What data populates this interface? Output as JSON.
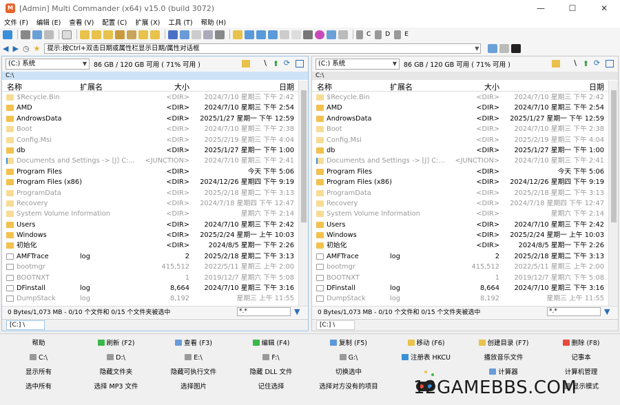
{
  "window": {
    "title": "[Admin] Multi Commander (x64)  v15.0 (build 3072)",
    "minimize": "—",
    "maximize": "☐",
    "close": "✕"
  },
  "menu": [
    "文件 (F)",
    "编辑 (E)",
    "查看 (V)",
    "配置 (C)",
    "扩展 (X)",
    "工具 (T)",
    "帮助 (H)"
  ],
  "drives": [
    "C",
    "D",
    "E"
  ],
  "cmdline": {
    "placeholder": "提示:按Ctrl+双击日期或属性栏显示日期/属性对话框"
  },
  "left": {
    "drive": "(C:) 系统",
    "free": "86 GB / 120 GB 可用 ( 71% 可用 )",
    "path": "C:\\",
    "headers": {
      "name": "名称",
      "ext": "扩展名",
      "size": "大小",
      "date": "日期"
    },
    "status": "0 Bytes/1,073 MB - 0/10 个文件和 0/15 个文件夹被选中",
    "filter": "*.*",
    "tab": "[C:] \\"
  },
  "right": {
    "drive": "(C:) 系统",
    "free": "86 GB / 120 GB 可用 ( 71% 可用 )",
    "path": "C:\\",
    "headers": {
      "name": "名称",
      "ext": "扩展名",
      "size": "大小",
      "date": "日期"
    },
    "status": "0 Bytes/1,073 MB - 0/10 个文件和 0/15 个文件夹被选中",
    "filter": "*.*",
    "tab": "[C:] \\"
  },
  "files": [
    {
      "name": "$Recycle.Bin",
      "ext": "",
      "size": "<DIR>",
      "date": "2024/7/10 星期三 下午 2:42",
      "hidden": true,
      "type": "folder"
    },
    {
      "name": "AMD",
      "ext": "",
      "size": "<DIR>",
      "date": "2024/7/10 星期三 下午 2:54",
      "hidden": false,
      "type": "folder"
    },
    {
      "name": "AndrowsData",
      "ext": "",
      "size": "<DIR>",
      "date": "2025/1/27 星期一 下午 12:59",
      "hidden": false,
      "type": "folder"
    },
    {
      "name": "Boot",
      "ext": "",
      "size": "<DIR>",
      "date": "2024/7/10 星期三 下午 2:38",
      "hidden": true,
      "type": "folder"
    },
    {
      "name": "Config.Msi",
      "ext": "",
      "size": "<DIR>",
      "date": "2025/2/19 星期三 下午 4:04",
      "hidden": true,
      "type": "folder"
    },
    {
      "name": "db",
      "ext": "",
      "size": "<DIR>",
      "date": "2025/1/27 星期一 下午 1:00",
      "hidden": false,
      "type": "folder"
    },
    {
      "name": "Documents and Settings ->  [J] C:...",
      "ext": "",
      "size": "<JUNCTION>",
      "date": "2024/7/10 星期三 下午 2:41",
      "hidden": true,
      "type": "link"
    },
    {
      "name": "Program Files",
      "ext": "",
      "size": "<DIR>",
      "date": "今天 下午 5:06",
      "hidden": false,
      "type": "folder"
    },
    {
      "name": "Program Files (x86)",
      "ext": "",
      "size": "<DIR>",
      "date": "2024/12/26 星期四 下午 9:19",
      "hidden": false,
      "type": "folder"
    },
    {
      "name": "ProgramData",
      "ext": "",
      "size": "<DIR>",
      "date": "2025/2/18 星期二 下午 3:13",
      "hidden": true,
      "type": "folder"
    },
    {
      "name": "Recovery",
      "ext": "",
      "size": "<DIR>",
      "date": "2024/7/18 星期四 下午 12:47",
      "hidden": true,
      "type": "folder"
    },
    {
      "name": "System Volume Information",
      "ext": "",
      "size": "<DIR>",
      "date": "星期六 下午 2:14",
      "hidden": true,
      "type": "folder"
    },
    {
      "name": "Users",
      "ext": "",
      "size": "<DIR>",
      "date": "2024/7/10 星期三 下午 2:42",
      "hidden": false,
      "type": "folder"
    },
    {
      "name": "Windows",
      "ext": "",
      "size": "<DIR>",
      "date": "2025/2/24 星期一 上午 10:03",
      "hidden": false,
      "type": "folder"
    },
    {
      "name": "初始化",
      "ext": "",
      "size": "<DIR>",
      "date": "2024/8/5 星期一 下午 2:26",
      "hidden": false,
      "type": "folder"
    },
    {
      "name": "AMFTrace",
      "ext": "log",
      "size": "2",
      "date": "2025/2/18 星期二 下午 3:13",
      "hidden": false,
      "type": "file"
    },
    {
      "name": "bootmgr",
      "ext": "",
      "size": "415,512",
      "date": "2022/5/11 星期三 上午 2:00",
      "hidden": true,
      "type": "file"
    },
    {
      "name": "BOOTNXT",
      "ext": "",
      "size": "1",
      "date": "2019/12/7 星期六 下午 5:08",
      "hidden": true,
      "type": "file"
    },
    {
      "name": "DFinstall",
      "ext": "log",
      "size": "8,664",
      "date": "2024/7/10 星期三 下午 3:16",
      "hidden": false,
      "type": "file"
    },
    {
      "name": "DumpStack",
      "ext": "log",
      "size": "8,192",
      "date": "星期三 上午 11:55",
      "hidden": true,
      "type": "file"
    }
  ],
  "buttons": [
    [
      "帮助",
      "刷新 (F2)",
      "查看 (F3)",
      "编辑 (F4)",
      "复制 (F5)",
      "移动 (F6)",
      "创建目录 (F7)",
      "删除 (F8)"
    ],
    [
      "C:\\",
      "D:\\",
      "E:\\",
      "F:\\",
      "G:\\",
      "注册表 HKCU",
      "播放音乐文件",
      "记事本"
    ],
    [
      "显示所有",
      "隐藏文件夹",
      "隐藏可执行文件",
      "隐藏 DLL 文件",
      "切换选中",
      "",
      "计算器",
      "计算机管理"
    ],
    [
      "选中所有",
      "选择 MP3 文件",
      "选择图片",
      "记住选择",
      "选择对方没有的项目",
      "选择",
      "",
      "显示模式"
    ]
  ],
  "watermark": "12GAMEBBS.COM",
  "colors": {
    "folder": "#f2c14e",
    "accent": "#3a8fd9",
    "selpath": "#cde3f7",
    "hidden_text": "#999999"
  }
}
